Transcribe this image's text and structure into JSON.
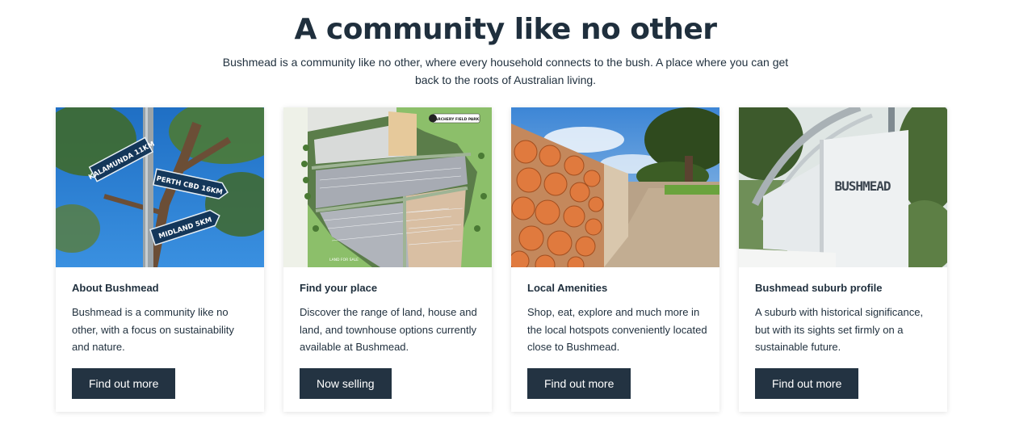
{
  "section": {
    "title": "A community like no other",
    "intro": "Bushmead is a community like no other, where every household connects to the bush. A place where you can get back to the roots of Australian living."
  },
  "cards": [
    {
      "title": "About Bushmead",
      "description": "Bushmead is a community like no other, with a focus on sustainability and nature.",
      "button": "Find out more",
      "image": {
        "signs": [
          "KALAMUNDA 11KM",
          "PERTH CBD 16KM",
          "MIDLAND 5KM"
        ]
      }
    },
    {
      "title": "Find your place",
      "description": "Discover the range of land, house and land, and townhouse options currently available at Bushmead.",
      "button": "Now selling",
      "image": {
        "map_label": "ARCHERY FIELD PARK",
        "lower_label": "LAND FOR SALE"
      }
    },
    {
      "title": "Local Amenities",
      "description": "Shop, eat, explore and much more in the local hotspots conveniently located close to Bushmead.",
      "button": "Find out more",
      "image": {}
    },
    {
      "title": "Bushmead suburb profile",
      "description": "A suburb with historical significance, but with its sights set firmly on a sustainable future.",
      "button": "Find out more",
      "image": {
        "wall_sign": "BUSHMEAD"
      }
    }
  ],
  "colors": {
    "heading": "#1f2f3d",
    "button_bg": "#233342",
    "button_text": "#ffffff",
    "sky": "#2b7fd0",
    "grass": "#8cbf6a"
  }
}
